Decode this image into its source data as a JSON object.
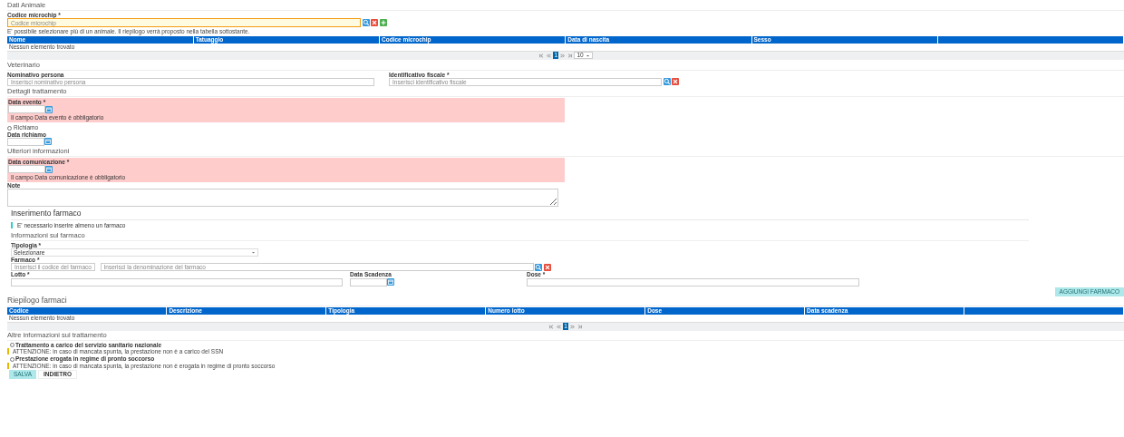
{
  "animal_section": {
    "title": "Dati Animale",
    "microchip": {
      "label": "Codice microchip *",
      "placeholder": "Codice microchip",
      "focused": true,
      "actions": [
        {
          "kind": "search"
        },
        {
          "kind": "delete"
        },
        {
          "kind": "add"
        }
      ]
    },
    "info": "E' possibile selezionare più di un animale. Il riepilogo verrà proposto nella tabella sottostante.",
    "table": {
      "columns": [
        "Nome",
        "Tatuaggio",
        "Codice microchip",
        "Data di nascita",
        "Sesso"
      ],
      "empty": "Nessun elemento trovato",
      "pager": {
        "controls": [
          {
            "kind": "first"
          },
          {
            "kind": "prev"
          },
          {
            "kind": "page",
            "label": "1",
            "selected": true
          },
          {
            "kind": "next"
          },
          {
            "kind": "last"
          }
        ],
        "page_size": "10"
      }
    }
  },
  "vet_section": {
    "title": "Veterinario",
    "fields": [
      {
        "label": "Nominativo persona",
        "placeholder": "Inserisci nominativo persona"
      },
      {
        "label": "Identificativo fiscale *",
        "placeholder": "Inserisci identificativo fiscale",
        "actions": [
          {
            "kind": "search"
          },
          {
            "kind": "delete"
          }
        ]
      }
    ]
  },
  "treatment_section": {
    "title": "Dettagli trattamento",
    "event_date": {
      "label": "Data evento *",
      "error": "Il campo Data evento è obbligatorio"
    },
    "recall": {
      "label": "Richiamo",
      "checked": false
    },
    "recall_date": {
      "label": "Data richiamo"
    }
  },
  "further_section": {
    "title": "Ulteriori informazioni",
    "communication_date": {
      "label": "Data comunicazione *",
      "error": "Il campo Data comunicazione è obbligatorio"
    },
    "notes": {
      "label": "Note"
    }
  },
  "drug_section": {
    "title": "Inserimento farmaco",
    "notice": "E' necessario inserire almeno un farmaco",
    "subtitle": "Informazioni sul farmaco",
    "type": {
      "label": "Tipologia *",
      "value": "Selezionare"
    },
    "drug": {
      "label": "Farmaco *",
      "code_placeholder": "Inserisci il codice del farmaco",
      "name_placeholder": "Inserisci la denominazione del farmaco",
      "actions": [
        {
          "kind": "search"
        },
        {
          "kind": "delete"
        }
      ]
    },
    "batch": {
      "label": "Lotto *"
    },
    "expiry": {
      "label": "Data Scadenza"
    },
    "dose": {
      "label": "Dose *"
    },
    "add_button": {
      "label": "AGGIUNGI FARMACO",
      "disabled": true
    }
  },
  "summary_section": {
    "title": "Riepilogo farmaci",
    "table": {
      "columns": [
        "Codice",
        "Descrizione",
        "Tipologia",
        "Numero lotto",
        "Dose",
        "Data scadenza"
      ],
      "empty": "Nessun elemento trovato",
      "pager": {
        "controls": [
          {
            "kind": "first"
          },
          {
            "kind": "prev"
          },
          {
            "kind": "page",
            "label": "1",
            "selected": true
          },
          {
            "kind": "next"
          },
          {
            "kind": "last"
          }
        ]
      }
    }
  },
  "other_section": {
    "title": "Altre informazioni sul trattamento",
    "options": [
      {
        "label": "Trattamento a carico del servizio sanitario nazionale",
        "checked": false,
        "warning": "ATTENZIONE: in caso di mancata spunta, la prestazione non è a carico del SSN"
      },
      {
        "label": "Prestazione erogata in regime di pronto soccorso",
        "checked": false,
        "warning": "ATTENZIONE: in caso di mancata spunta, la prestazione non è erogata in regime di pronto soccorso"
      }
    ]
  },
  "buttons": [
    {
      "label": "SALVA",
      "kind": "primary",
      "disabled": true
    },
    {
      "label": "INDIETRO",
      "kind": "secondary",
      "disabled": false
    }
  ]
}
